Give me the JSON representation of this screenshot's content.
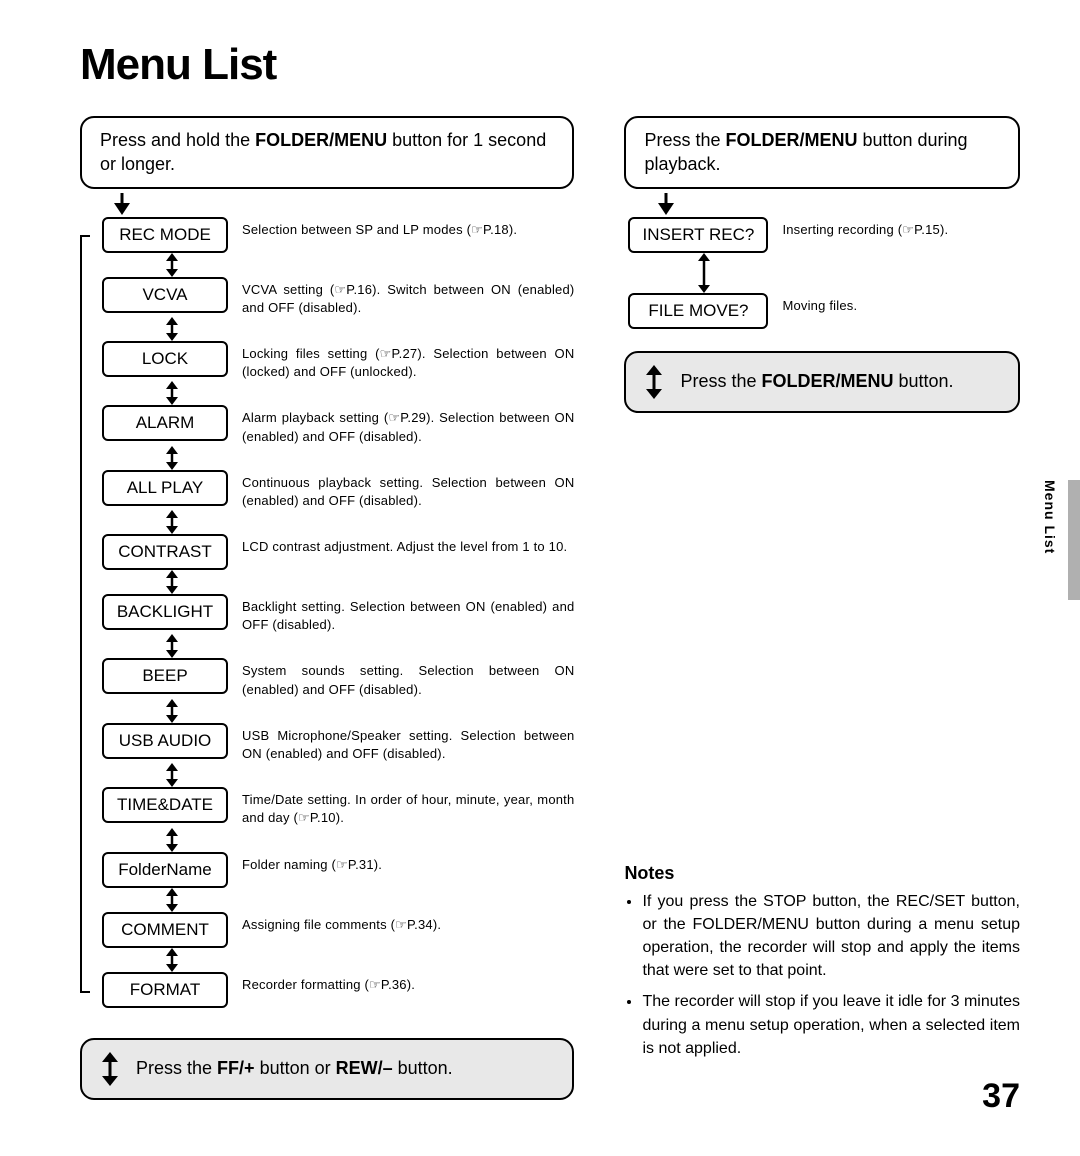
{
  "title": "Menu List",
  "left_top_instruction_prefix": "Press and hold the ",
  "left_top_instruction_bold": "FOLDER/MENU",
  "left_top_instruction_suffix": " button for 1 second or longer.",
  "right_top_instruction_prefix": "Press the ",
  "right_top_instruction_bold": "FOLDER/MENU",
  "right_top_instruction_suffix": " button during playback.",
  "left_items": [
    {
      "label": "REC MODE",
      "desc": "Selection between SP and LP modes (☞P.18)."
    },
    {
      "label": "VCVA",
      "desc": "VCVA setting (☞P.16). Switch between ON (enabled) and OFF (disabled)."
    },
    {
      "label": "LOCK",
      "desc": "Locking files setting (☞P.27). Selection between ON (locked) and OFF (unlocked)."
    },
    {
      "label": "ALARM",
      "desc": "Alarm playback setting (☞P.29). Selection between ON (enabled) and OFF (disabled)."
    },
    {
      "label": "ALL PLAY",
      "desc": "Continuous playback setting. Selection between ON (enabled) and OFF (disabled)."
    },
    {
      "label": "CONTRAST",
      "desc": "LCD contrast adjustment. Adjust the level from 1 to 10."
    },
    {
      "label": "BACKLIGHT",
      "desc": "Backlight setting. Selection between ON (enabled) and OFF (disabled)."
    },
    {
      "label": "BEEP",
      "desc": "System sounds setting. Selection between ON (enabled) and OFF (disabled)."
    },
    {
      "label": "USB AUDIO",
      "desc": "USB Microphone/Speaker setting. Selection between ON (enabled) and OFF (disabled)."
    },
    {
      "label": "TIME&DATE",
      "desc": "Time/Date setting. In order of hour, minute, year, month and day (☞P.10)."
    },
    {
      "label": "FolderName",
      "desc": "Folder naming (☞P.31)."
    },
    {
      "label": "COMMENT",
      "desc": "Assigning file comments (☞P.34)."
    },
    {
      "label": "FORMAT",
      "desc": "Recorder formatting (☞P.36)."
    }
  ],
  "right_items": [
    {
      "label": "INSERT REC?",
      "desc": "Inserting recording (☞P.15)."
    },
    {
      "label": "FILE MOVE?",
      "desc": "Moving files."
    }
  ],
  "footer_left_prefix": "Press the ",
  "footer_left_bold1": "FF/+",
  "footer_left_mid": " button or ",
  "footer_left_bold2": "REW/–",
  "footer_left_suffix": " button.",
  "footer_right_prefix": "Press the ",
  "footer_right_bold": "FOLDER/MENU",
  "footer_right_suffix": " button.",
  "notes_heading": "Notes",
  "notes": [
    "If you press the STOP button, the REC/SET button, or the FOLDER/MENU button during a menu setup operation, the recorder will stop and apply the items that were set to that point.",
    "The recorder will stop if you leave it idle for 3 minutes during a menu setup operation, when a selected item is not applied."
  ],
  "side_label": "Menu List",
  "page_number": "37"
}
